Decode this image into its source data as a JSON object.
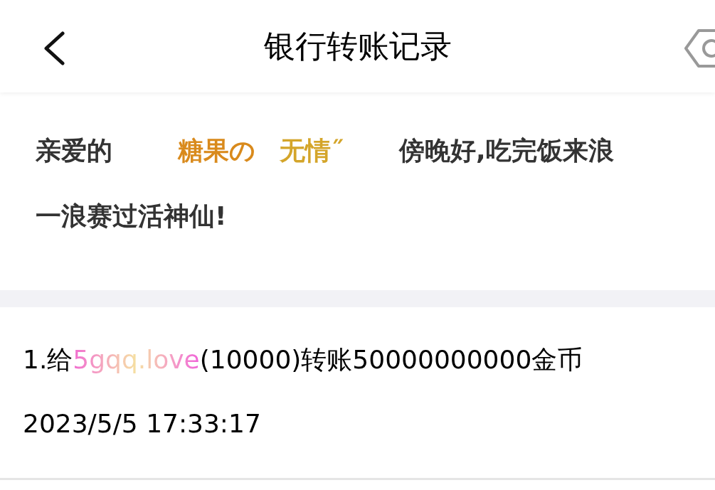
{
  "header": {
    "title": "银行转账记录"
  },
  "greeting": {
    "line1": [
      {
        "kind": "plain",
        "text": "亲爱的"
      },
      {
        "kind": "name1",
        "text": "糖果の"
      },
      {
        "kind": "name2",
        "text": "无情˝"
      },
      {
        "kind": "plain",
        "text": "傍晚好,吃完饭来浪"
      }
    ],
    "line2": "一浪赛过活神仙!"
  },
  "records": [
    {
      "prefix": "1.给",
      "name": "5gqq.love",
      "suffix": "(10000)转账50000000000金币",
      "time": "2023/5/5 17:33:17"
    }
  ]
}
